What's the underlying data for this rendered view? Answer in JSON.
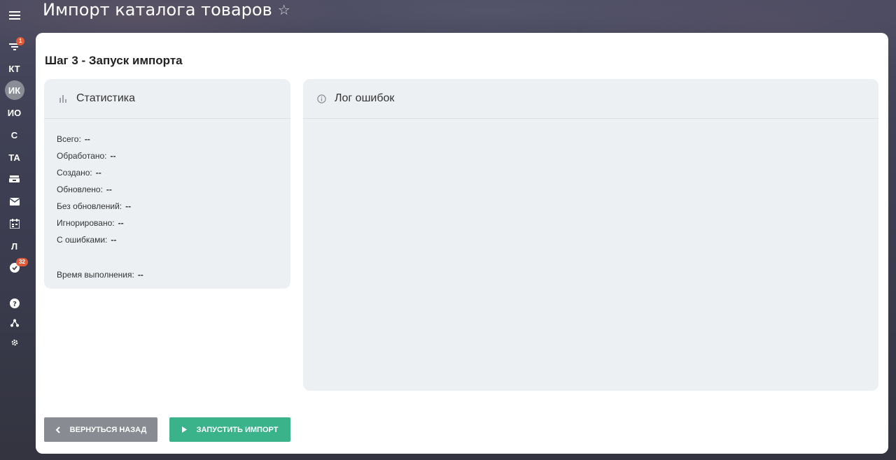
{
  "header": {
    "title": "Импорт каталога товаров"
  },
  "sidebar": {
    "items": [
      {
        "label": "",
        "icon": "menu-icon"
      },
      {
        "label": "",
        "icon": "filter-icon",
        "badge": "1"
      },
      {
        "label": "КТ"
      },
      {
        "label": "ИК",
        "active": true
      },
      {
        "label": "ИО"
      },
      {
        "label": "С"
      },
      {
        "label": "ТА"
      },
      {
        "label": "",
        "icon": "inbox-icon"
      },
      {
        "label": "",
        "icon": "mail-icon"
      },
      {
        "label": "",
        "icon": "calendar-icon"
      },
      {
        "label": "Л"
      },
      {
        "label": "",
        "icon": "check-circle-icon",
        "badge": "32"
      },
      {
        "label": "",
        "icon": "help-icon"
      },
      {
        "label": "",
        "icon": "structure-icon"
      },
      {
        "label": "",
        "icon": "gear-icon"
      }
    ]
  },
  "main": {
    "step_title": "Шаг 3 - Запуск импорта",
    "stats": {
      "title": "Статистика",
      "rows": [
        {
          "label": "Всего:",
          "value": "--"
        },
        {
          "label": "Обработано:",
          "value": "--"
        },
        {
          "label": "Создано:",
          "value": "--"
        },
        {
          "label": "Обновлено:",
          "value": "--"
        },
        {
          "label": "Без обновлений:",
          "value": "--"
        },
        {
          "label": "Игнорировано:",
          "value": "--"
        },
        {
          "label": "С ошибками:",
          "value": "--"
        }
      ],
      "time": {
        "label": "Время выполнения:",
        "value": "--"
      }
    },
    "errors": {
      "title": "Лог ошибок"
    },
    "buttons": {
      "back": "Вернуться назад",
      "run": "Запустить импорт"
    }
  },
  "colors": {
    "accent": "#3ab38a",
    "badge": "#e05a3a",
    "panel": "#edf0f3"
  }
}
